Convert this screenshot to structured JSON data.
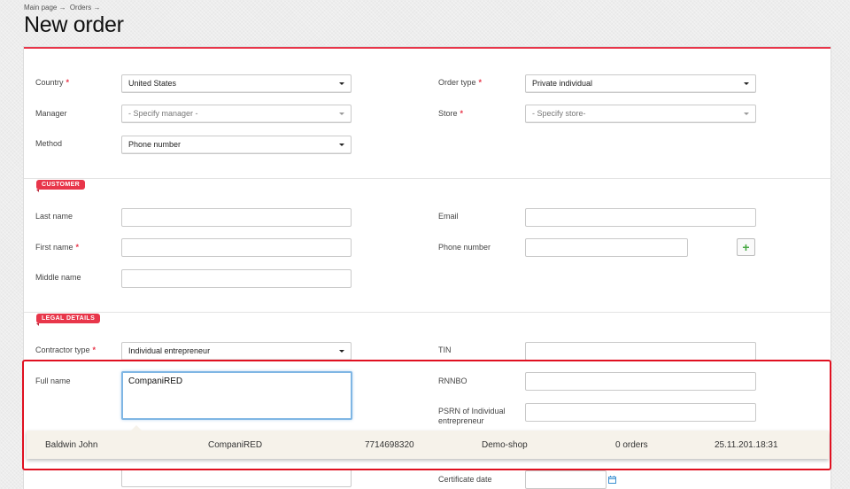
{
  "breadcrumb": {
    "items": [
      "Main page →",
      "Orders →"
    ]
  },
  "page": {
    "title": "New order"
  },
  "order": {
    "country_label": "Country",
    "country_value": "United States",
    "manager_label": "Manager",
    "manager_placeholder": "- Specify manager -",
    "method_label": "Method",
    "method_value": "Phone number",
    "order_type_label": "Order type",
    "order_type_value": "Private individual",
    "store_label": "Store",
    "store_placeholder": "- Specify store-",
    "required_mark": "*"
  },
  "customer": {
    "section_tag": "CUSTOMER",
    "last_name_label": "Last name",
    "last_name_value": "",
    "first_name_label": "First name",
    "first_name_value": "",
    "middle_name_label": "Middle name",
    "middle_name_value": "",
    "email_label": "Email",
    "email_value": "",
    "phone_label": "Phone number",
    "phone_value": "",
    "add_phone_label": "+"
  },
  "legal": {
    "section_tag": "LEGAL DETAILS",
    "contractor_type_label": "Contractor type",
    "contractor_type_value": "Individual entrepreneur",
    "full_name_label": "Full name",
    "full_name_value": "CompaniRED",
    "tin_label": "TIN",
    "tin_value": "",
    "rnnbo_label": "RNNBO",
    "rnnbo_value": "",
    "psrn_label": "PSRN of Individual entrepreneur",
    "psrn_value": "",
    "certificate_date_label": "Certificate date",
    "certificate_date_value": ""
  },
  "suggestion": {
    "name": "Baldwin John",
    "company": "CompaniRED",
    "number": "7714698320",
    "shop": "Demo-shop",
    "orders": "0 orders",
    "date": "25.11.201.18:31"
  },
  "colors": {
    "accent": "#e8364a",
    "highlight": "#e01020",
    "focus": "#7fb6e4",
    "add_button": "#47a843"
  },
  "icons": {
    "dropdown": "chevron-down-icon",
    "calendar": "calendar-icon",
    "add": "plus-icon"
  }
}
